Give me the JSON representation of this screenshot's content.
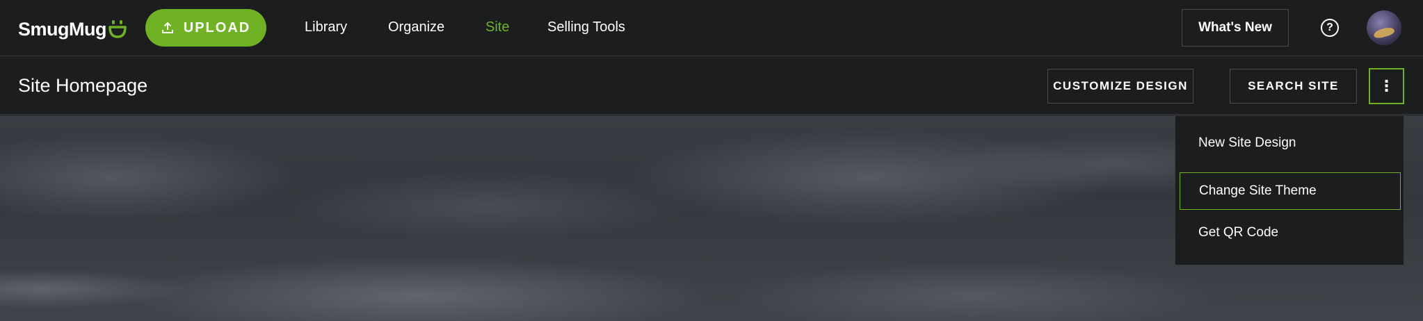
{
  "brand": {
    "name": "SmugMug",
    "accent": "#6fb325"
  },
  "topbar": {
    "upload_label": "UPLOAD",
    "nav": [
      {
        "label": "Library"
      },
      {
        "label": "Organize"
      },
      {
        "label": "Site",
        "active": true
      },
      {
        "label": "Selling Tools"
      }
    ],
    "whats_new_label": "What's New",
    "help_icon": "question-circle-icon",
    "help_glyph": "?"
  },
  "subbar": {
    "title": "Site Homepage",
    "customize_label": "CUSTOMIZE DESIGN",
    "search_label": "SEARCH SITE",
    "more_glyph": "⋮"
  },
  "menu": {
    "items": [
      {
        "label": "New Site Design"
      },
      {
        "label": "Change Site Theme",
        "focused": true
      },
      {
        "label": "Get QR Code"
      }
    ]
  }
}
